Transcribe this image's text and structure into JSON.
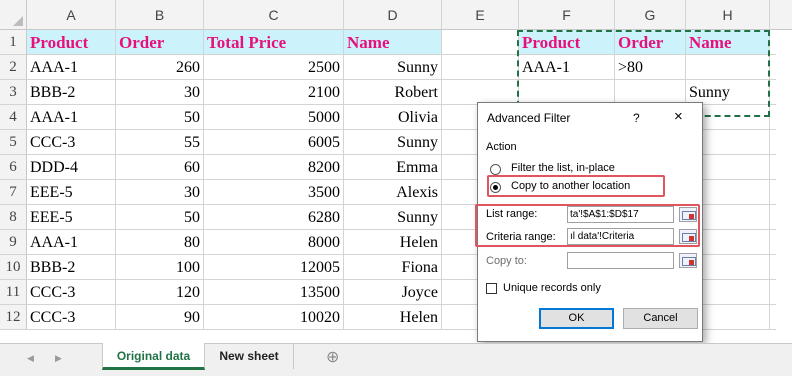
{
  "columns": [
    "A",
    "B",
    "C",
    "D",
    "E",
    "F",
    "G",
    "H"
  ],
  "rows": [
    "1",
    "2",
    "3",
    "4",
    "5",
    "6",
    "7",
    "8",
    "9",
    "10",
    "11",
    "12"
  ],
  "headers": [
    "Product",
    "Order",
    "Total Price",
    "Name"
  ],
  "data": [
    [
      "AAA-1",
      "260",
      "2500",
      "Sunny"
    ],
    [
      "BBB-2",
      "30",
      "2100",
      "Robert"
    ],
    [
      "AAA-1",
      "50",
      "5000",
      "Olivia"
    ],
    [
      "CCC-3",
      "55",
      "6005",
      "Sunny"
    ],
    [
      "DDD-4",
      "60",
      "8200",
      "Emma"
    ],
    [
      "EEE-5",
      "30",
      "3500",
      "Alexis"
    ],
    [
      "EEE-5",
      "50",
      "6280",
      "Sunny"
    ],
    [
      "AAA-1",
      "80",
      "8000",
      "Helen"
    ],
    [
      "BBB-2",
      "100",
      "12005",
      "Fiona"
    ],
    [
      "CCC-3",
      "120",
      "13500",
      "Joyce"
    ],
    [
      "CCC-3",
      "90",
      "10020",
      "Helen"
    ]
  ],
  "criteria": {
    "headers": [
      "Product",
      "Order",
      "Name"
    ],
    "row2": [
      "AAA-1",
      ">80",
      ""
    ],
    "row3": [
      "",
      "",
      "Sunny"
    ]
  },
  "dialog": {
    "title": "Advanced Filter",
    "help": "?",
    "close": "×",
    "action_label": "Action",
    "option_filter": "Filter the list, in-place",
    "option_copy": "Copy to another location",
    "selected_option": "copy",
    "list_range_label": "List range:",
    "list_range_value": "ta'!$A$1:$D$17",
    "criteria_range_label": "Criteria range:",
    "criteria_range_value": "ıl data'!Criteria",
    "copy_to_label": "Copy to:",
    "copy_to_value": "",
    "unique_label": "Unique records only",
    "unique_checked": false,
    "ok_label": "OK",
    "cancel_label": "Cancel"
  },
  "tabs": {
    "sheets": [
      "Original data",
      "New sheet"
    ],
    "active": "Original data",
    "add_icon": "⊕",
    "nav_prev": "◀",
    "nav_next": "▶"
  },
  "colors": {
    "header_bg": "#ccf2fb",
    "header_text": "#e8117b",
    "criteria_border": "#217346",
    "highlight": "#e0555f",
    "active_tab": "#217346"
  }
}
